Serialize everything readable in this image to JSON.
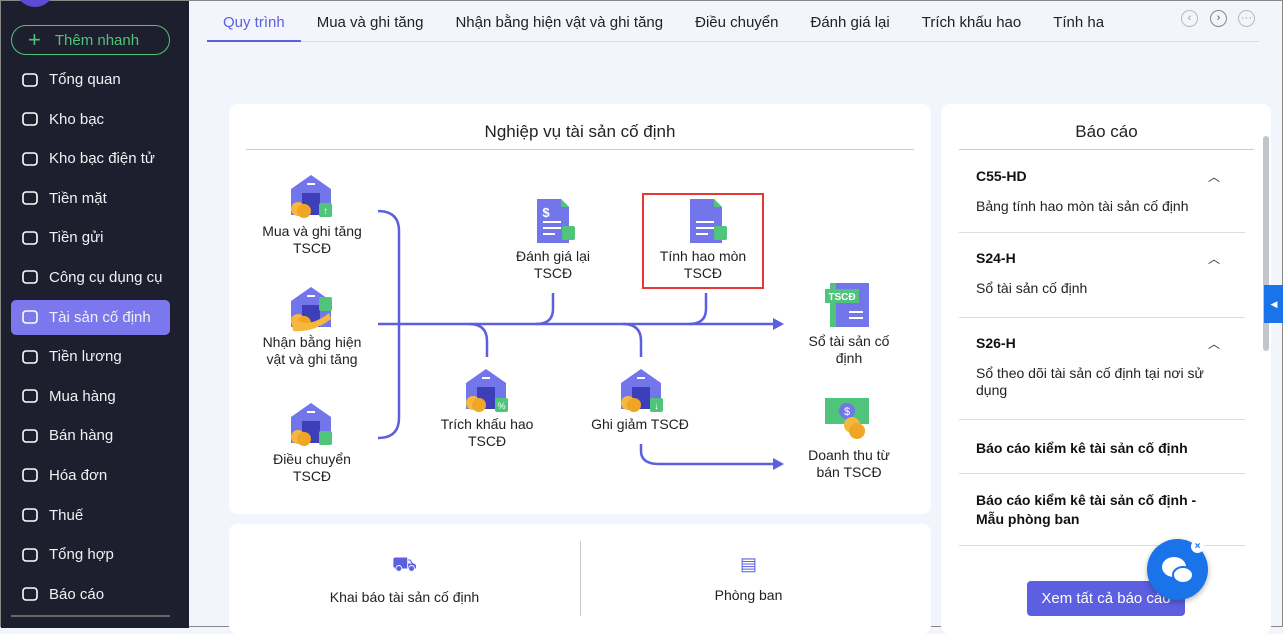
{
  "sidebar": {
    "quick_add": "Thêm nhanh",
    "items": [
      {
        "label": "Tổng quan",
        "icon": "pie-chart-icon"
      },
      {
        "label": "Kho bạc",
        "icon": "treasury-icon"
      },
      {
        "label": "Kho bạc điện tử",
        "icon": "e-treasury-icon"
      },
      {
        "label": "Tiền mặt",
        "icon": "cash-icon"
      },
      {
        "label": "Tiền gửi",
        "icon": "deposit-icon"
      },
      {
        "label": "Công cụ dụng cụ",
        "icon": "tools-icon"
      },
      {
        "label": "Tài sản cố định",
        "icon": "truck-icon",
        "active": true
      },
      {
        "label": "Tiền lương",
        "icon": "salary-icon"
      },
      {
        "label": "Mua hàng",
        "icon": "cart-icon"
      },
      {
        "label": "Bán hàng",
        "icon": "store-icon"
      },
      {
        "label": "Hóa đơn",
        "icon": "invoice-icon"
      },
      {
        "label": "Thuế",
        "icon": "tax-icon"
      },
      {
        "label": "Tổng hợp",
        "icon": "summary-icon"
      },
      {
        "label": "Báo cáo",
        "icon": "report-icon"
      }
    ]
  },
  "tabs": [
    "Quy trình",
    "Mua và ghi tăng",
    "Nhận bằng hiện vật và ghi tăng",
    "Điều chuyển",
    "Đánh giá lại",
    "Trích khấu hao",
    "Tính ha"
  ],
  "process": {
    "title": "Nghiệp vụ tài sản cố định",
    "nodes": {
      "mua": "Mua và ghi tăng\nTSCĐ",
      "nhan": "Nhận bằng hiện\nvật và ghi tăng",
      "dieu": "Điều chuyển\nTSCĐ",
      "danhgia": "Đánh giá lại\nTSCĐ",
      "tinhhao": "Tính hao mòn\nTSCĐ",
      "trich": "Trích khấu hao\nTSCĐ",
      "ghigiam": "Ghi giảm TSCĐ",
      "so": "Sổ tài sản cố\nđịnh",
      "doanhthu": "Doanh thu từ\nbán TSCĐ"
    },
    "badge": "TSCĐ",
    "highlight_color": "#e53935"
  },
  "bottom": {
    "khai_bao": "Khai báo tài sản cố định",
    "phong_ban": "Phòng ban"
  },
  "reports": {
    "title": "Báo cáo",
    "items": [
      {
        "code": "C55-HD",
        "desc": "Bảng tính hao mòn tài sản cố định"
      },
      {
        "code": "S24-H",
        "desc": "Sổ tài sản cố định"
      },
      {
        "code": "S26-H",
        "desc": "Sổ theo dõi tài sản cố định tại nơi sử dụng"
      },
      {
        "code": "Báo cáo kiểm kê tài sản cố định"
      },
      {
        "code": "Báo cáo kiểm kê tài sản cố định - Mẫu phòng ban"
      }
    ],
    "view_all": "Xem tất cả báo cáo"
  },
  "colors": {
    "accent": "#5b5fe0",
    "sidebar": "#1e1f2e",
    "active": "#7b78ee",
    "green": "#4fc47a"
  }
}
